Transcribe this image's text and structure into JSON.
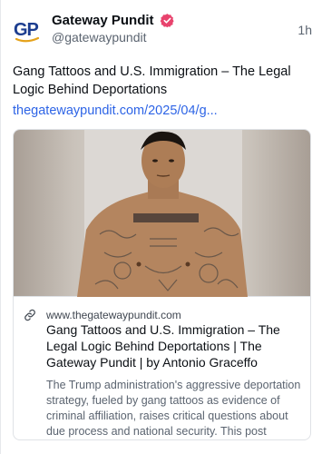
{
  "post": {
    "author": {
      "display_name": "Gateway Pundit",
      "handle": "@gatewaypundit",
      "avatar_text": "GP",
      "verified_icon": "verified-badge-icon"
    },
    "timestamp": "1h",
    "text": "Gang Tattoos and U.S. Immigration – The Legal Logic Behind Deportations",
    "link": "thegatewaypundit.com/2025/04/g..."
  },
  "link_card": {
    "icon": "link-icon",
    "domain": "www.thegatewaypundit.com",
    "title": "Gang Tattoos and U.S. Immigration – The Legal Logic Behind Deportations | The Gateway Pundit | by Antonio Graceffo",
    "description": "The Trump administration's aggressive deportation strategy, fueled by gang tattoos as evidence of criminal affiliation, raises critical questions about due process and national security. This post unpacks the legal implications of such actions."
  },
  "colors": {
    "link": "#2d64e6",
    "verified": "#e8436d",
    "avatar_blue": "#1c3d8f",
    "avatar_gold": "#e5a21a"
  }
}
